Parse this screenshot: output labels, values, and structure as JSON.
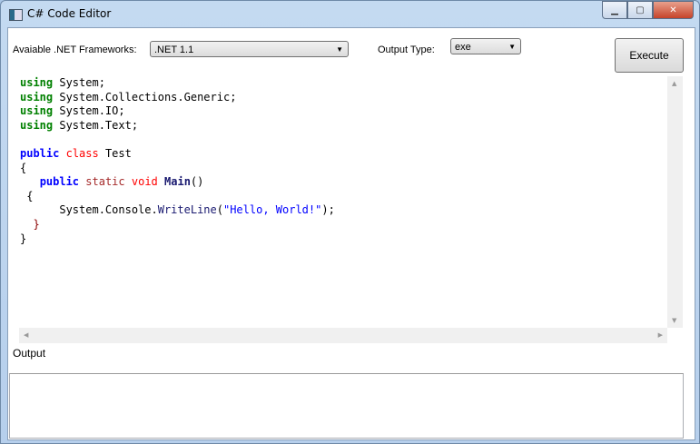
{
  "window": {
    "title": "C# Code Editor"
  },
  "toolbar": {
    "frameworks_label": "Avaiable .NET Frameworks:",
    "framework_selected": ".NET 1.1",
    "output_type_label": "Output Type:",
    "output_type_selected": "exe",
    "execute_label": "Execute"
  },
  "editor": {
    "lines": [
      [
        [
          "kw-using",
          "using"
        ],
        [
          "plain",
          " System;"
        ]
      ],
      [
        [
          "kw-using",
          "using"
        ],
        [
          "plain",
          " System.Collections.Generic;"
        ]
      ],
      [
        [
          "kw-using",
          "using"
        ],
        [
          "plain",
          " System.IO;"
        ]
      ],
      [
        [
          "kw-using",
          "using"
        ],
        [
          "plain",
          " System.Text;"
        ]
      ],
      [],
      [
        [
          "kw-public",
          "public"
        ],
        [
          "plain",
          " "
        ],
        [
          "kw-class",
          "class"
        ],
        [
          "plain",
          " Test"
        ]
      ],
      [
        [
          "plain",
          "{"
        ]
      ],
      [
        [
          "plain",
          "   "
        ],
        [
          "kw-public",
          "public"
        ],
        [
          "plain",
          " "
        ],
        [
          "kw-static",
          "static"
        ],
        [
          "plain",
          " "
        ],
        [
          "kw-void",
          "void"
        ],
        [
          "plain",
          " "
        ],
        [
          "fn",
          "Main"
        ],
        [
          "plain",
          "()"
        ]
      ],
      [
        [
          "plain",
          " {"
        ]
      ],
      [
        [
          "plain",
          "      System.Console."
        ],
        [
          "method",
          "WriteLine"
        ],
        [
          "plain",
          "("
        ],
        [
          "str",
          "\"Hello, World!\""
        ],
        [
          "plain",
          ");"
        ]
      ],
      [
        [
          "brace2",
          "  }"
        ]
      ],
      [
        [
          "plain",
          "}"
        ]
      ]
    ]
  },
  "output": {
    "label": "Output",
    "value": ""
  }
}
